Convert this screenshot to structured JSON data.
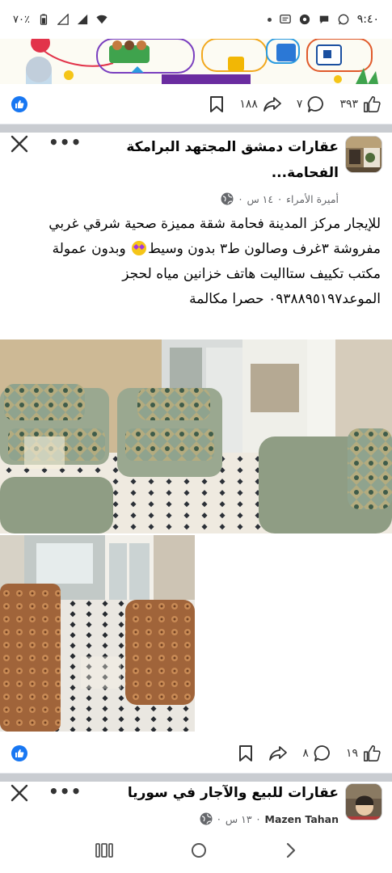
{
  "status_bar": {
    "time": "٩:٤٠",
    "battery": "٧٠٪"
  },
  "post1_actions": {
    "likes": "٣٩٣",
    "comments": "٧",
    "shares": "١٨٨"
  },
  "post2": {
    "group_name_line1": "عقارات دمشق المجتهد البرامكة",
    "group_name_line2": "الفحامة...",
    "author": "أميرة الأمراء",
    "time": "١٤ س",
    "text_line1": "للإيجار مركز المدينة فحامة شقة مميزة صحية شرقي غربي",
    "text_line2a": "مفروشة ٣غرف وصالون ط٣ بدون وسيط",
    "text_line2b": " وبدون عمولة",
    "text_line3": "مكتب تكييف ستااليت هاتف خزانين مياه لحجز",
    "text_line4": "الموعد٠٩٣٨٨٩٥١٩٧ حصرا مكالمة",
    "likes": "١٩",
    "comments": "٨"
  },
  "post3": {
    "group_name": "عقارات للبيع والآجار في سوريا",
    "author": "Mazen Tahan",
    "time": "١٣ س"
  },
  "icons": {
    "like": "thumb-up-icon",
    "comment": "comment-icon",
    "share": "share-arrow-icon",
    "save": "bookmark-icon",
    "close": "close-icon",
    "more": "more-dots-icon",
    "globe": "globe-icon"
  },
  "colors": {
    "facebook_blue": "#1877f2",
    "separator": "#c9ccd1",
    "meta_gray": "#65676b"
  }
}
